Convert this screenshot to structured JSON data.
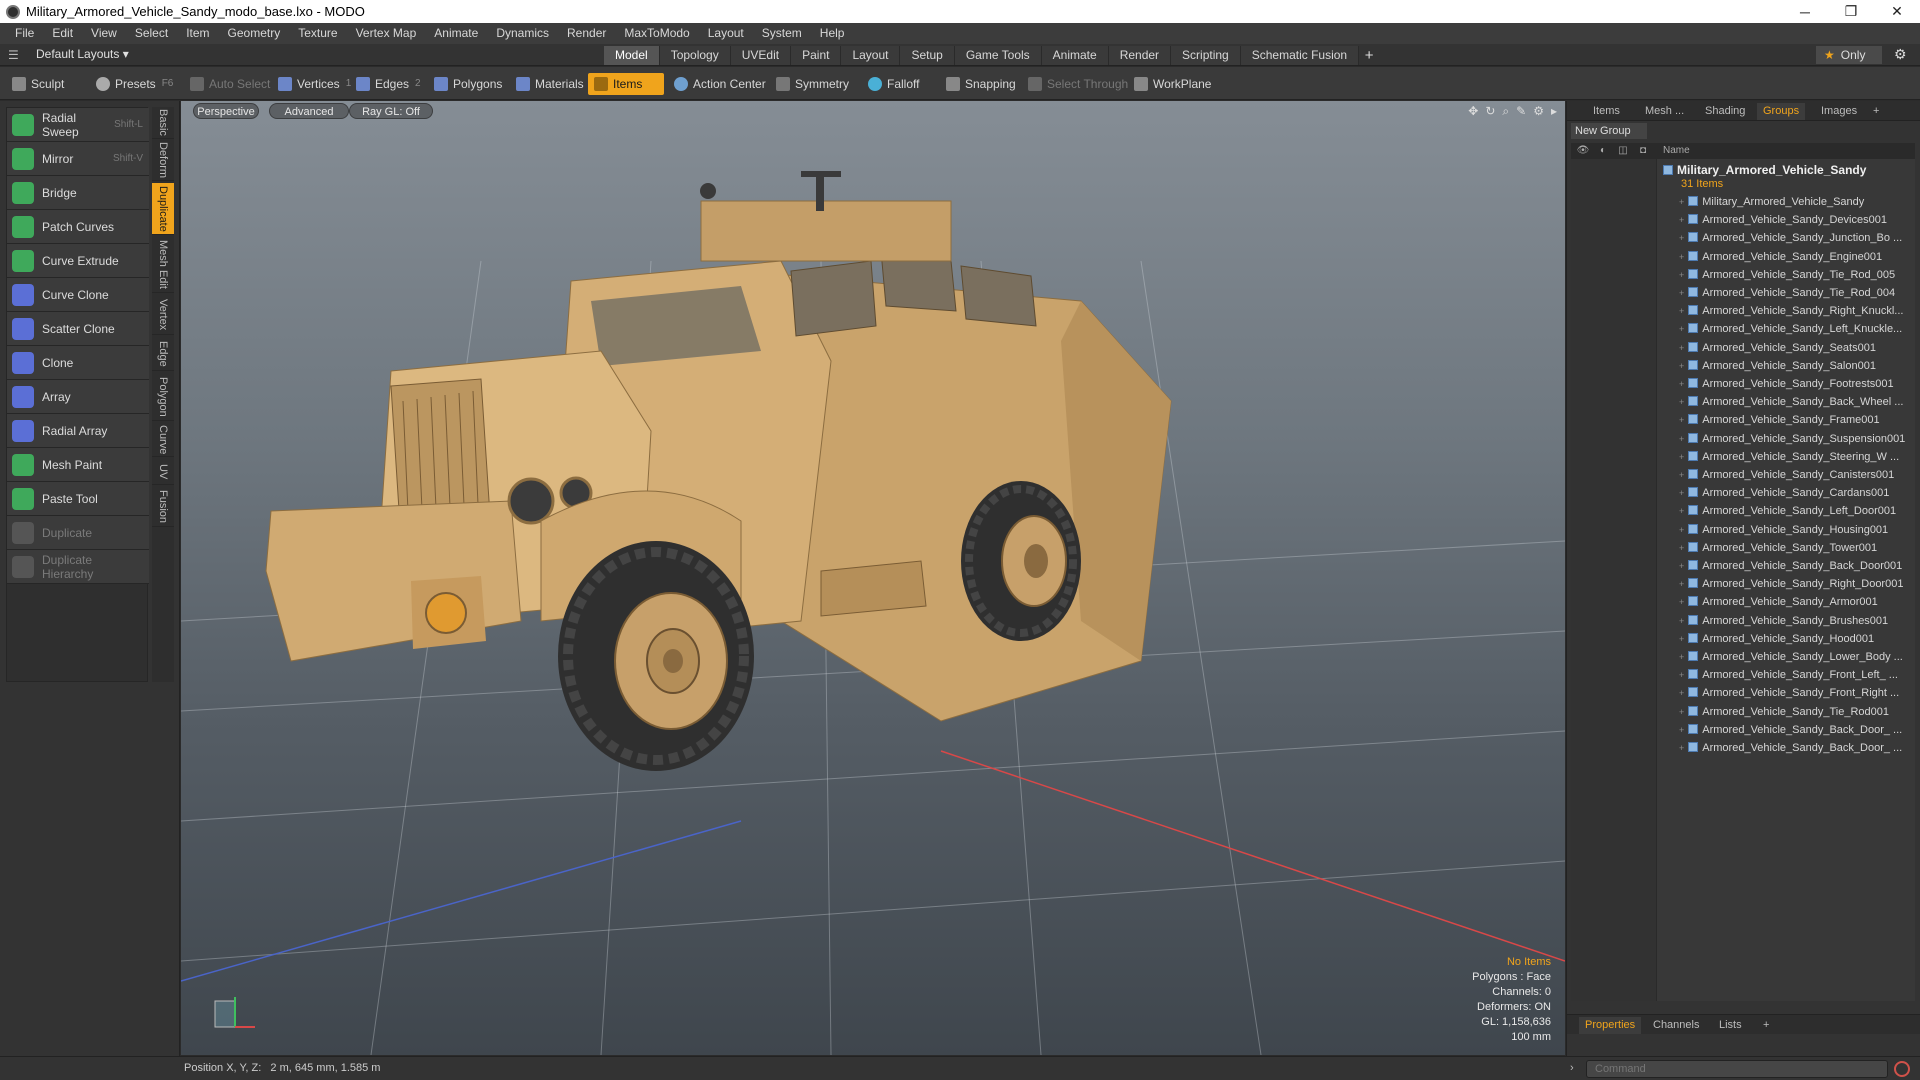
{
  "window": {
    "title": "Military_Armored_Vehicle_Sandy_modo_base.lxo - MODO",
    "controls": [
      "─",
      "❐",
      "✕"
    ]
  },
  "menu": [
    "File",
    "Edit",
    "View",
    "Select",
    "Item",
    "Geometry",
    "Texture",
    "Vertex Map",
    "Animate",
    "Dynamics",
    "Render",
    "MaxToModo",
    "Layout",
    "System",
    "Help"
  ],
  "layout_bar": {
    "layout_label": "Default Layouts ▾",
    "tabs": [
      "Model",
      "Topology",
      "UVEdit",
      "Paint",
      "Layout",
      "Setup",
      "Game Tools",
      "Animate",
      "Render",
      "Scripting",
      "Schematic Fusion"
    ],
    "active_tab": "Model",
    "add": "+",
    "only_label": "Only"
  },
  "toolbar": {
    "sculpt": "Sculpt",
    "presets": "Presets",
    "presets_key": "F6",
    "auto_select": "Auto Select",
    "vertices": "Vertices",
    "vertices_count": "1",
    "edges": "Edges",
    "edges_count": "2",
    "polygons": "Polygons",
    "materials": "Materials",
    "items": "Items",
    "action_center": "Action Center",
    "symmetry": "Symmetry",
    "falloff": "Falloff",
    "snapping": "Snapping",
    "select_through": "Select Through",
    "workplane": "WorkPlane"
  },
  "tools": [
    {
      "label": "Radial Sweep",
      "key": "Shift-L",
      "color": "#3fa95b"
    },
    {
      "label": "Mirror",
      "key": "Shift-V",
      "color": "#3fa95b"
    },
    {
      "label": "Bridge",
      "key": "",
      "color": "#3fa95b"
    },
    {
      "label": "Patch Curves",
      "key": "",
      "color": "#3fa95b"
    },
    {
      "label": "Curve Extrude",
      "key": "",
      "color": "#3fa95b"
    },
    {
      "label": "Curve Clone",
      "key": "",
      "color": "#5b6fd6"
    },
    {
      "label": "Scatter Clone",
      "key": "",
      "color": "#5b6fd6"
    },
    {
      "label": "Clone",
      "key": "",
      "color": "#5b6fd6"
    },
    {
      "label": "Array",
      "key": "",
      "color": "#5b6fd6"
    },
    {
      "label": "Radial Array",
      "key": "",
      "color": "#5b6fd6"
    },
    {
      "label": "Mesh Paint",
      "key": "",
      "color": "#3fa95b"
    },
    {
      "label": "Paste Tool",
      "key": "",
      "color": "#3fa95b"
    },
    {
      "label": "Duplicate",
      "key": "",
      "color": "#666666",
      "disabled": true
    },
    {
      "label": "Duplicate Hierarchy",
      "key": "",
      "color": "#666666",
      "disabled": true
    }
  ],
  "vtabs": [
    "Basic",
    "Deform",
    "Duplicate",
    "Mesh Edit",
    "Vertex",
    "Edge",
    "Polygon",
    "Curve",
    "UV",
    "Fusion"
  ],
  "active_vtab": "Duplicate",
  "viewport": {
    "view_mode": "Perspective",
    "shading": "Advanced",
    "raygl": "Ray GL: Off",
    "info": {
      "selection": "No Items",
      "polygons": "Polygons : Face",
      "channels": "Channels: 0",
      "deformers": "Deformers: ON",
      "gl": "GL: 1,158,636",
      "scale": "100 mm"
    },
    "icons": [
      "move-icon",
      "rotate-icon",
      "zoom-icon",
      "brush-icon",
      "gear-icon",
      "play-icon"
    ]
  },
  "right_panel": {
    "tabs": [
      "Items",
      "Mesh ...",
      "Shading",
      "Groups",
      "Images",
      "+"
    ],
    "active_tab": "Groups",
    "new_group": "New Group",
    "name_header": "Name",
    "group_name": "Military_Armored_Vehicle_Sandy",
    "group_count": "31 Items",
    "items": [
      "Military_Armored_Vehicle_Sandy",
      "Armored_Vehicle_Sandy_Devices001",
      "Armored_Vehicle_Sandy_Junction_Bo ...",
      "Armored_Vehicle_Sandy_Engine001",
      "Armored_Vehicle_Sandy_Tie_Rod_005",
      "Armored_Vehicle_Sandy_Tie_Rod_004",
      "Armored_Vehicle_Sandy_Right_Knuckl...",
      "Armored_Vehicle_Sandy_Left_Knuckle...",
      "Armored_Vehicle_Sandy_Seats001",
      "Armored_Vehicle_Sandy_Salon001",
      "Armored_Vehicle_Sandy_Footrests001",
      "Armored_Vehicle_Sandy_Back_Wheel ...",
      "Armored_Vehicle_Sandy_Frame001",
      "Armored_Vehicle_Sandy_Suspension001",
      "Armored_Vehicle_Sandy_Steering_W ...",
      "Armored_Vehicle_Sandy_Canisters001",
      "Armored_Vehicle_Sandy_Cardans001",
      "Armored_Vehicle_Sandy_Left_Door001",
      "Armored_Vehicle_Sandy_Housing001",
      "Armored_Vehicle_Sandy_Tower001",
      "Armored_Vehicle_Sandy_Back_Door001",
      "Armored_Vehicle_Sandy_Right_Door001",
      "Armored_Vehicle_Sandy_Armor001",
      "Armored_Vehicle_Sandy_Brushes001",
      "Armored_Vehicle_Sandy_Hood001",
      "Armored_Vehicle_Sandy_Lower_Body ...",
      "Armored_Vehicle_Sandy_Front_Left_ ...",
      "Armored_Vehicle_Sandy_Front_Right ...",
      "Armored_Vehicle_Sandy_Tie_Rod001",
      "Armored_Vehicle_Sandy_Back_Door_ ...",
      "Armored_Vehicle_Sandy_Back_Door_ ..."
    ],
    "props_tabs": [
      "Properties",
      "Channels",
      "Lists",
      "+"
    ],
    "active_props_tab": "Properties"
  },
  "status": {
    "position_label": "Position X, Y, Z:",
    "position_value": "2 m, 645 mm, 1.585 m",
    "command_placeholder": "Command"
  },
  "colors": {
    "accent": "#f0a41c",
    "vehicle": "#d9b47e",
    "tire": "#2f2f2f"
  }
}
